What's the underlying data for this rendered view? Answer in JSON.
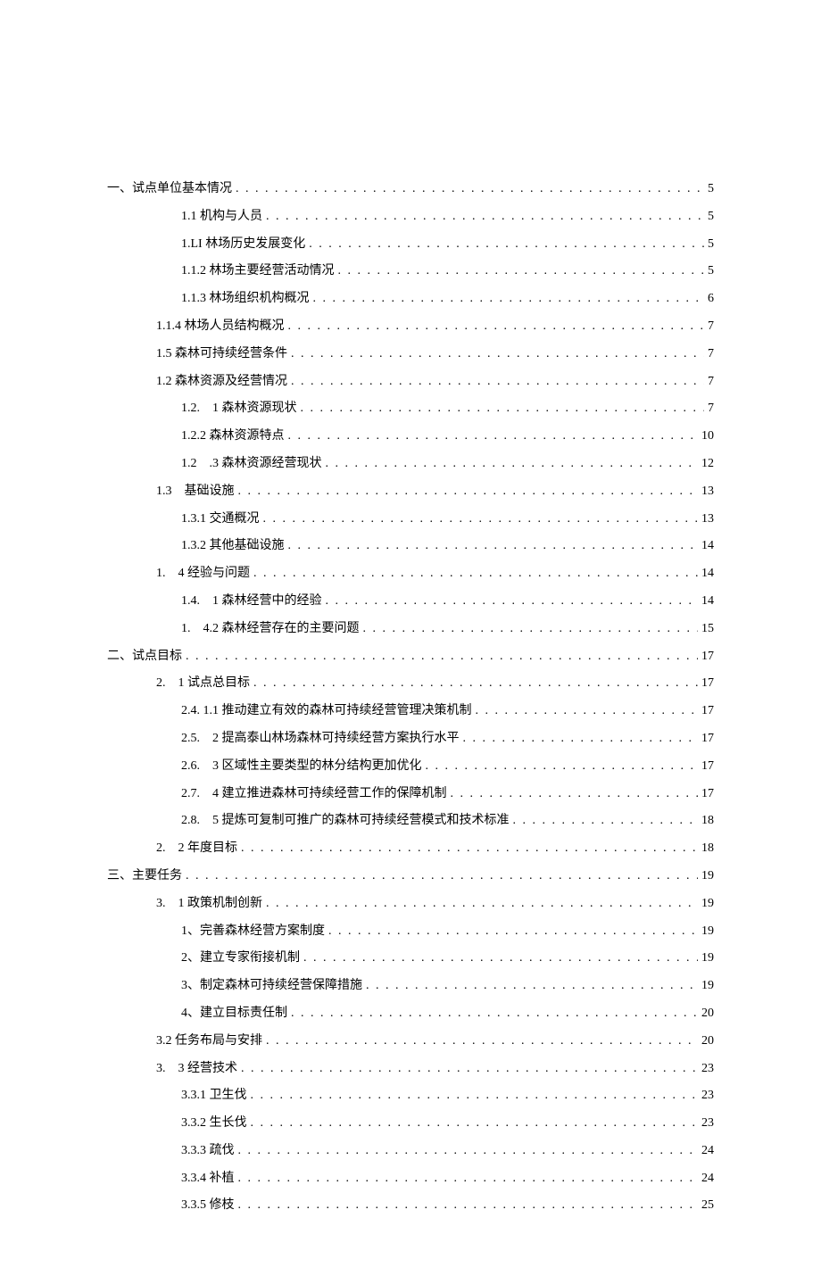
{
  "toc": [
    {
      "indent": 0,
      "label": "一、试点单位基本情况",
      "page": "5"
    },
    {
      "indent": 2,
      "label": "1.1 机构与人员",
      "page": "5"
    },
    {
      "indent": 2,
      "label": "1.LI 林场历史发展变化",
      "page": "5"
    },
    {
      "indent": 2,
      "label": "1.1.2 林场主要经营活动情况",
      "page": "5"
    },
    {
      "indent": 2,
      "label": "1.1.3 林场组织机构概况",
      "page": "6"
    },
    {
      "indent": 1,
      "label": "1.1.4 林场人员结构概况",
      "page": "7"
    },
    {
      "indent": 1,
      "label": "1.5 森林可持续经营条件",
      "page": "7"
    },
    {
      "indent": 1,
      "label": "1.2 森林资源及经营情况",
      "page": "7"
    },
    {
      "indent": 2,
      "label": "1.2.　1 森林资源现状",
      "page": "7"
    },
    {
      "indent": 2,
      "label": "1.2.2 森林资源特点",
      "page": "10"
    },
    {
      "indent": 2,
      "label": "1.2　.3 森林资源经营现状",
      "page": "12"
    },
    {
      "indent": 1,
      "label": "1.3　基础设施",
      "page": "13"
    },
    {
      "indent": 2,
      "label": "1.3.1 交通概况",
      "page": "13"
    },
    {
      "indent": 2,
      "label": "1.3.2 其他基础设施",
      "page": "14"
    },
    {
      "indent": 1,
      "label": "1.　4 经验与问题",
      "page": "14"
    },
    {
      "indent": 2,
      "label": "1.4.　1 森林经营中的经验",
      "page": "14"
    },
    {
      "indent": 2,
      "label": "1.　4.2 森林经营存在的主要问题",
      "page": "15"
    },
    {
      "indent": 0,
      "label": "二、试点目标",
      "page": "17"
    },
    {
      "indent": 1,
      "label": "2.　1 试点总目标",
      "page": "17"
    },
    {
      "indent": 2,
      "label": "2.4. 1.1 推动建立有效的森林可持续经营管理决策机制",
      "page": "17"
    },
    {
      "indent": 2,
      "label": "2.5.　2 提高泰山林场森林可持续经营方案执行水平",
      "page": "17"
    },
    {
      "indent": 2,
      "label": "2.6.　3 区域性主要类型的林分结构更加优化",
      "page": "17"
    },
    {
      "indent": 2,
      "label": "2.7.　4 建立推进森林可持续经营工作的保障机制",
      "page": "17"
    },
    {
      "indent": 2,
      "label": "2.8.　5 提炼可复制可推广的森林可持续经营模式和技术标准",
      "page": "18"
    },
    {
      "indent": 1,
      "label": "2.　2 年度目标",
      "page": "18"
    },
    {
      "indent": 0,
      "label": "三、主要任务",
      "page": "19"
    },
    {
      "indent": 1,
      "label": "3.　1 政策机制创新",
      "page": "19"
    },
    {
      "indent": 2,
      "label": "1、完善森林经营方案制度",
      "page": "19"
    },
    {
      "indent": 2,
      "label": "2、建立专家衔接机制",
      "page": "19"
    },
    {
      "indent": 2,
      "label": "3、制定森林可持续经营保障措施",
      "page": "19"
    },
    {
      "indent": 2,
      "label": "4、建立目标责任制",
      "page": "20"
    },
    {
      "indent": 1,
      "label": "3.2 任务布局与安排",
      "page": "20"
    },
    {
      "indent": 1,
      "label": "3.　3 经营技术",
      "page": "23"
    },
    {
      "indent": 2,
      "label": "3.3.1 卫生伐",
      "page": "23"
    },
    {
      "indent": 2,
      "label": "3.3.2 生长伐",
      "page": "23"
    },
    {
      "indent": 2,
      "label": "3.3.3 疏伐",
      "page": "24"
    },
    {
      "indent": 2,
      "label": "3.3.4 补植",
      "page": "24"
    },
    {
      "indent": 2,
      "label": "3.3.5 修枝",
      "page": "25"
    }
  ]
}
